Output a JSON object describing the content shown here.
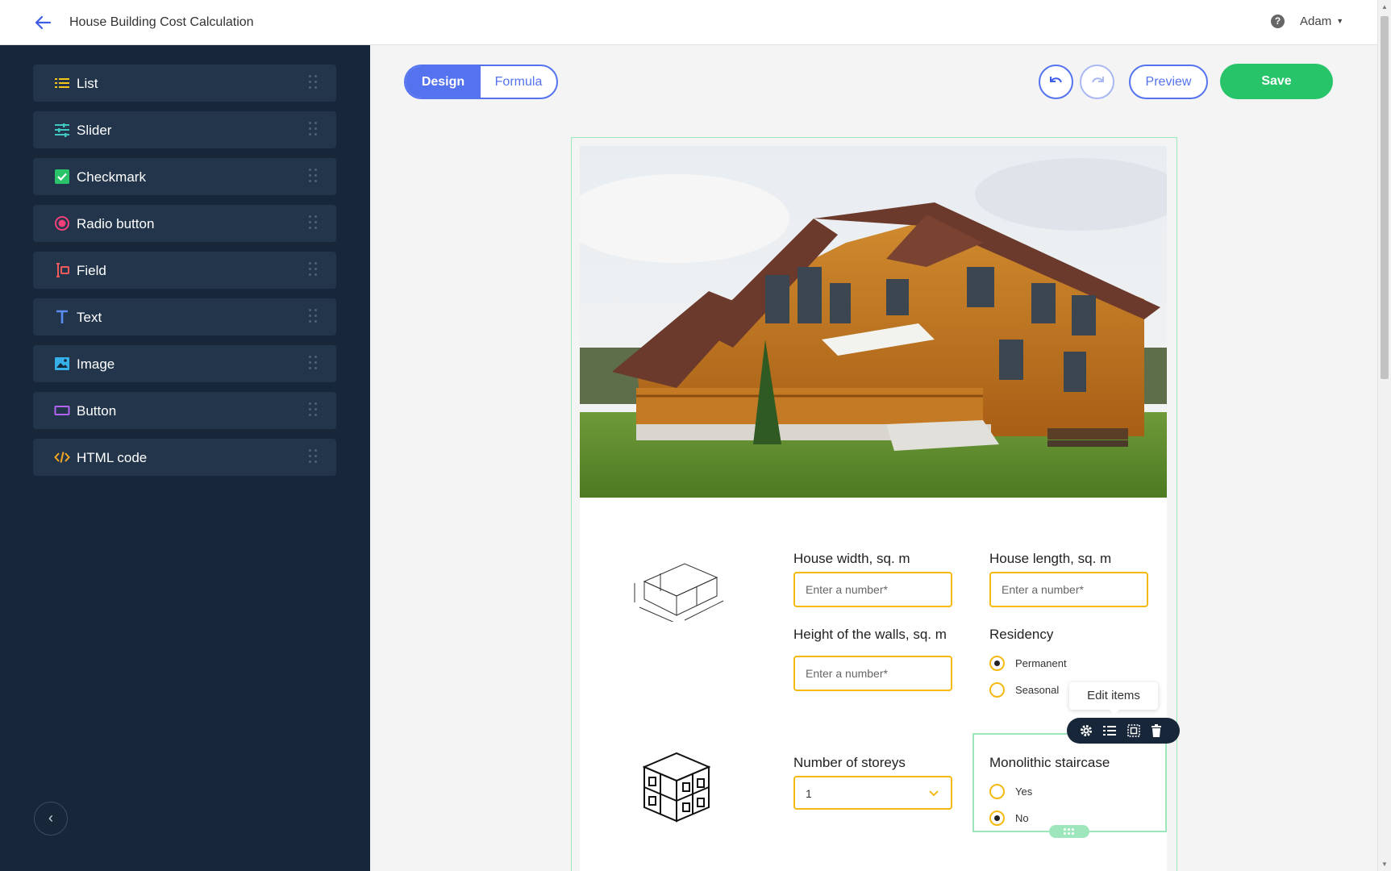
{
  "header": {
    "title": "House Building Cost Calculation",
    "user": "Adam"
  },
  "sidebar": {
    "items": [
      {
        "label": "List",
        "icon": "list-icon"
      },
      {
        "label": "Slider",
        "icon": "slider-icon"
      },
      {
        "label": "Checkmark",
        "icon": "checkmark-icon"
      },
      {
        "label": "Radio button",
        "icon": "radio-icon"
      },
      {
        "label": "Field",
        "icon": "field-icon"
      },
      {
        "label": "Text",
        "icon": "text-icon"
      },
      {
        "label": "Image",
        "icon": "image-icon"
      },
      {
        "label": "Button",
        "icon": "button-icon"
      },
      {
        "label": "HTML code",
        "icon": "html-code-icon"
      }
    ]
  },
  "toolbar": {
    "design": "Design",
    "formula": "Formula",
    "preview": "Preview",
    "save": "Save"
  },
  "form": {
    "width_label": "House width, sq. m",
    "length_label": "House length, sq. m",
    "height_label": "Height of the walls, sq. m",
    "residency_label": "Residency",
    "placeholder": "Enter a number*",
    "residency_options": [
      "Permanent",
      "Seasonal"
    ],
    "storeys_label": "Number of storeys",
    "storeys_value": "1",
    "staircase_label": "Monolithic staircase",
    "staircase_options": [
      "Yes",
      "No"
    ]
  },
  "tooltip": "Edit items",
  "colors": {
    "accent": "#5573ef",
    "save": "#27c46a",
    "sidebar": "#172638",
    "input_border": "#f5b912",
    "selection": "#9ee6bb"
  }
}
